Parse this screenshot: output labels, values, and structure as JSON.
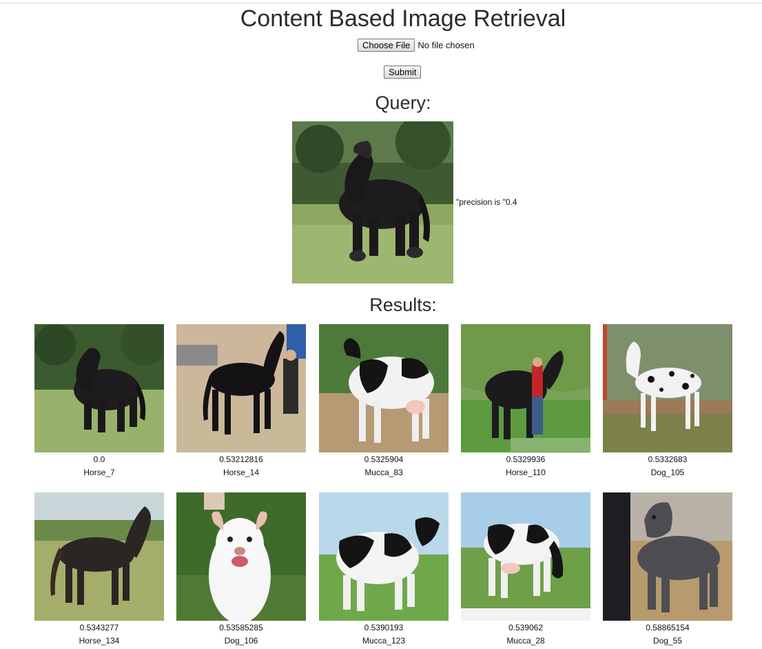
{
  "page": {
    "title": "Content Based Image Retrieval"
  },
  "upload": {
    "choose_label": "Choose File",
    "status": "No file chosen",
    "submit_label": "Submit"
  },
  "query": {
    "heading": "Query:",
    "precision_text": "\"precision is \"0.4",
    "image_subject": "horse"
  },
  "results": {
    "heading": "Results:",
    "items": [
      {
        "score": "0.0",
        "label": "Horse_7",
        "subject": "horse"
      },
      {
        "score": "0.53212816",
        "label": "Horse_14",
        "subject": "horse"
      },
      {
        "score": "0.5325904",
        "label": "Mucca_83",
        "subject": "cow"
      },
      {
        "score": "0.5329936",
        "label": "Horse_110",
        "subject": "horse"
      },
      {
        "score": "0.5332683",
        "label": "Dog_105",
        "subject": "dog"
      },
      {
        "score": "0.5343277",
        "label": "Horse_134",
        "subject": "horse"
      },
      {
        "score": "0.53585285",
        "label": "Dog_106",
        "subject": "dog"
      },
      {
        "score": "0.5390193",
        "label": "Mucca_123",
        "subject": "cow"
      },
      {
        "score": "0.539062",
        "label": "Mucca_28",
        "subject": "cow"
      },
      {
        "score": "0.58865154",
        "label": "Dog_55",
        "subject": "dog"
      }
    ]
  }
}
